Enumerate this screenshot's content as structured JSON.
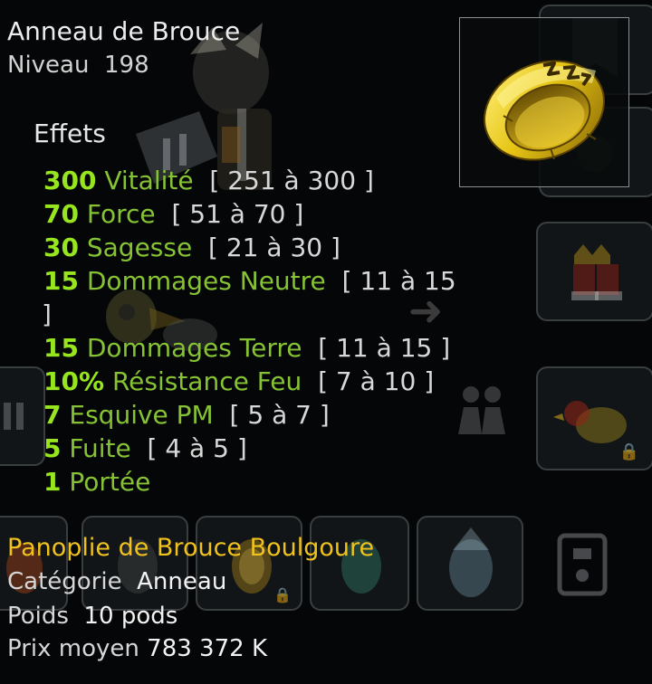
{
  "item": {
    "name": "Anneau de Brouce",
    "level_label": "Niveau",
    "level_value": "198",
    "icon": "gold-ring-icon"
  },
  "effects_title": "Effets",
  "effects": [
    {
      "value": "300",
      "name": "Vitalité",
      "range": "[ 251 à 300 ]"
    },
    {
      "value": "70",
      "name": "Force",
      "range": "[ 51 à 70 ]"
    },
    {
      "value": "30",
      "name": "Sagesse",
      "range": "[ 21 à 30 ]"
    },
    {
      "value": "15",
      "name": "Dommages Neutre",
      "range": "[ 11 à 15",
      "range_cont": "]"
    },
    {
      "value": "15",
      "name": "Dommages Terre",
      "range": "[ 11 à 15 ]"
    },
    {
      "value": "10%",
      "name": "Résistance Feu",
      "range": "[ 7 à 10 ]"
    },
    {
      "value": "7",
      "name": "Esquive PM",
      "range": "[ 5 à 7 ]"
    },
    {
      "value": "5",
      "name": "Fuite",
      "range": "[ 4 à 5 ]"
    },
    {
      "value": "1",
      "name": "Portée",
      "range": ""
    }
  ],
  "set": {
    "name": "Panoplie de Brouce Boulgoure"
  },
  "category": {
    "label": "Catégorie",
    "value": "Anneau"
  },
  "weight": {
    "label": "Poids",
    "value": "10 pods"
  },
  "price": {
    "label": "Prix moyen",
    "value": "783 372 K"
  },
  "colors": {
    "effect_value": "#97e51e",
    "effect_name": "#86c334",
    "set_name": "#f0c21e",
    "background": "#050607"
  }
}
